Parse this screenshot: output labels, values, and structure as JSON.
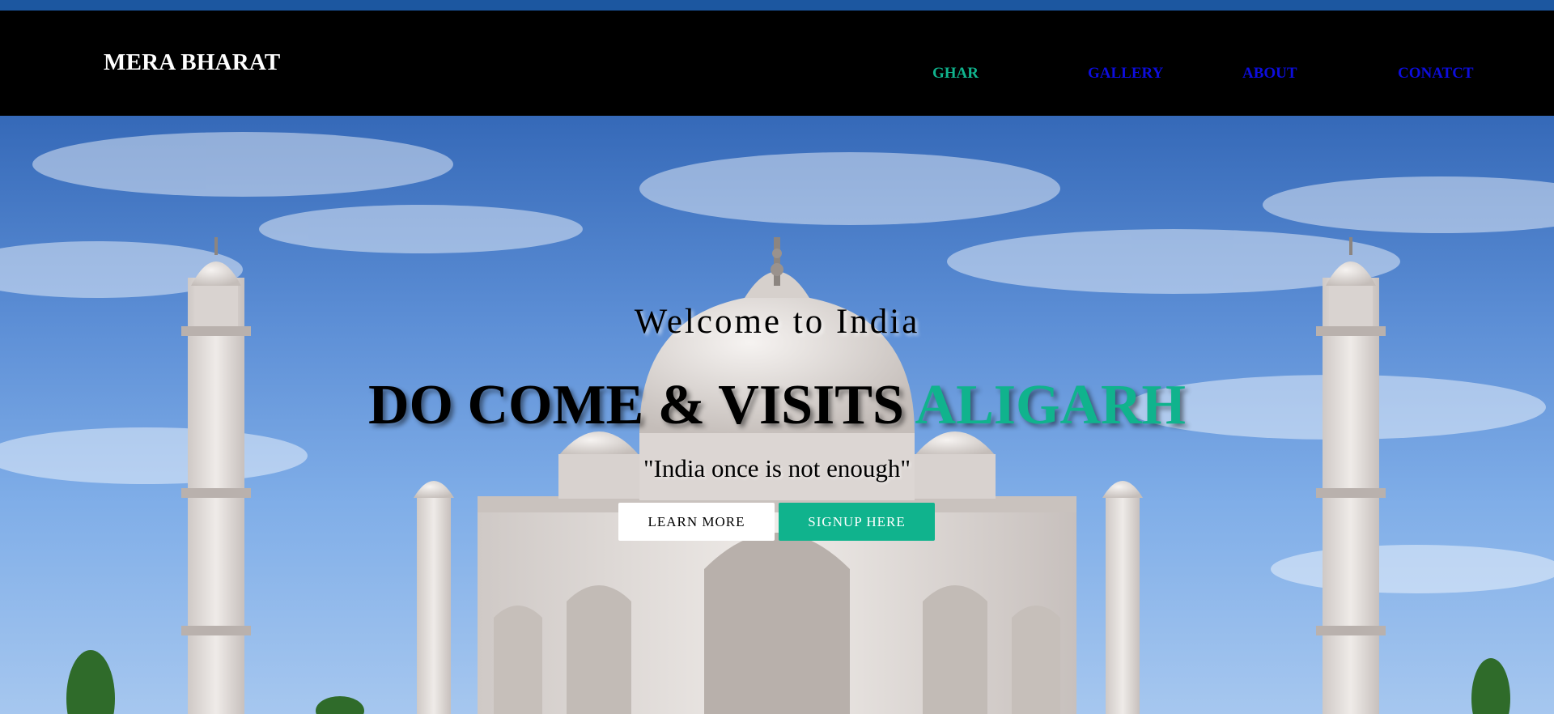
{
  "header": {
    "brand": "MERA BHARAT",
    "nav": [
      {
        "label": "GHAR",
        "active": true
      },
      {
        "label": "GALLERY",
        "active": false
      },
      {
        "label": "ABOUT",
        "active": false
      },
      {
        "label": "CONATCT",
        "active": false
      }
    ]
  },
  "hero": {
    "welcome": "Welcome to India",
    "headline_main": "DO COME & VISITS ",
    "headline_accent": "ALIGARH",
    "tagline": "\"India once is not enough\"",
    "buttons": {
      "learn_more": "LEARN MORE",
      "signup": "SIGNUP HERE"
    },
    "background_image": "taj-mahal"
  },
  "colors": {
    "accent": "#10b38d",
    "nav_link": "#0d0ddd",
    "topbar": "#1c57a0",
    "navbar_bg": "#000000"
  }
}
